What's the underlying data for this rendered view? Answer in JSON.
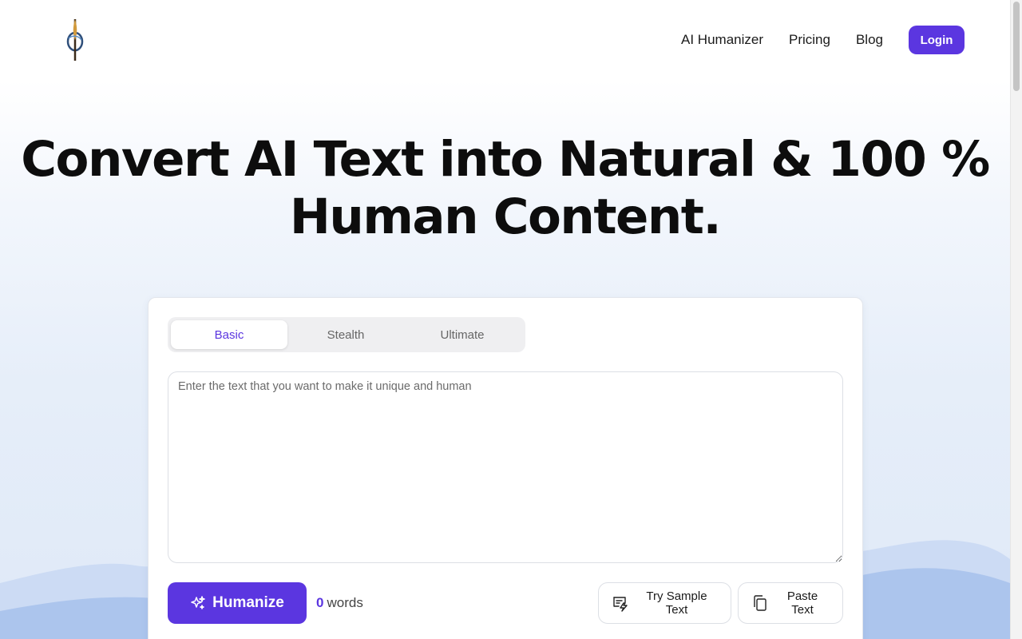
{
  "header": {
    "logo_name": "phi-quill-logo",
    "nav": [
      {
        "label": "AI Humanizer"
      },
      {
        "label": "Pricing"
      },
      {
        "label": "Blog"
      }
    ],
    "login_label": "Login"
  },
  "hero": {
    "title_line1": "Convert AI Text into Natural & 100 %",
    "title_line2": "Human Content."
  },
  "tool": {
    "tabs": [
      {
        "label": "Basic",
        "active": true
      },
      {
        "label": "Stealth",
        "active": false
      },
      {
        "label": "Ultimate",
        "active": false
      }
    ],
    "input": {
      "value": "",
      "placeholder": "Enter the text that you want to make it unique and human"
    },
    "humanize_label": "Humanize",
    "word_count": "0",
    "word_count_unit": "words",
    "sample_label": "Try Sample Text",
    "paste_label": "Paste Text"
  },
  "colors": {
    "accent": "#5b36e0",
    "mountain": "#a9c2ec"
  },
  "icons": {
    "humanize": "sparkles-icon",
    "sample": "sample-text-icon",
    "paste": "copy-icon"
  }
}
